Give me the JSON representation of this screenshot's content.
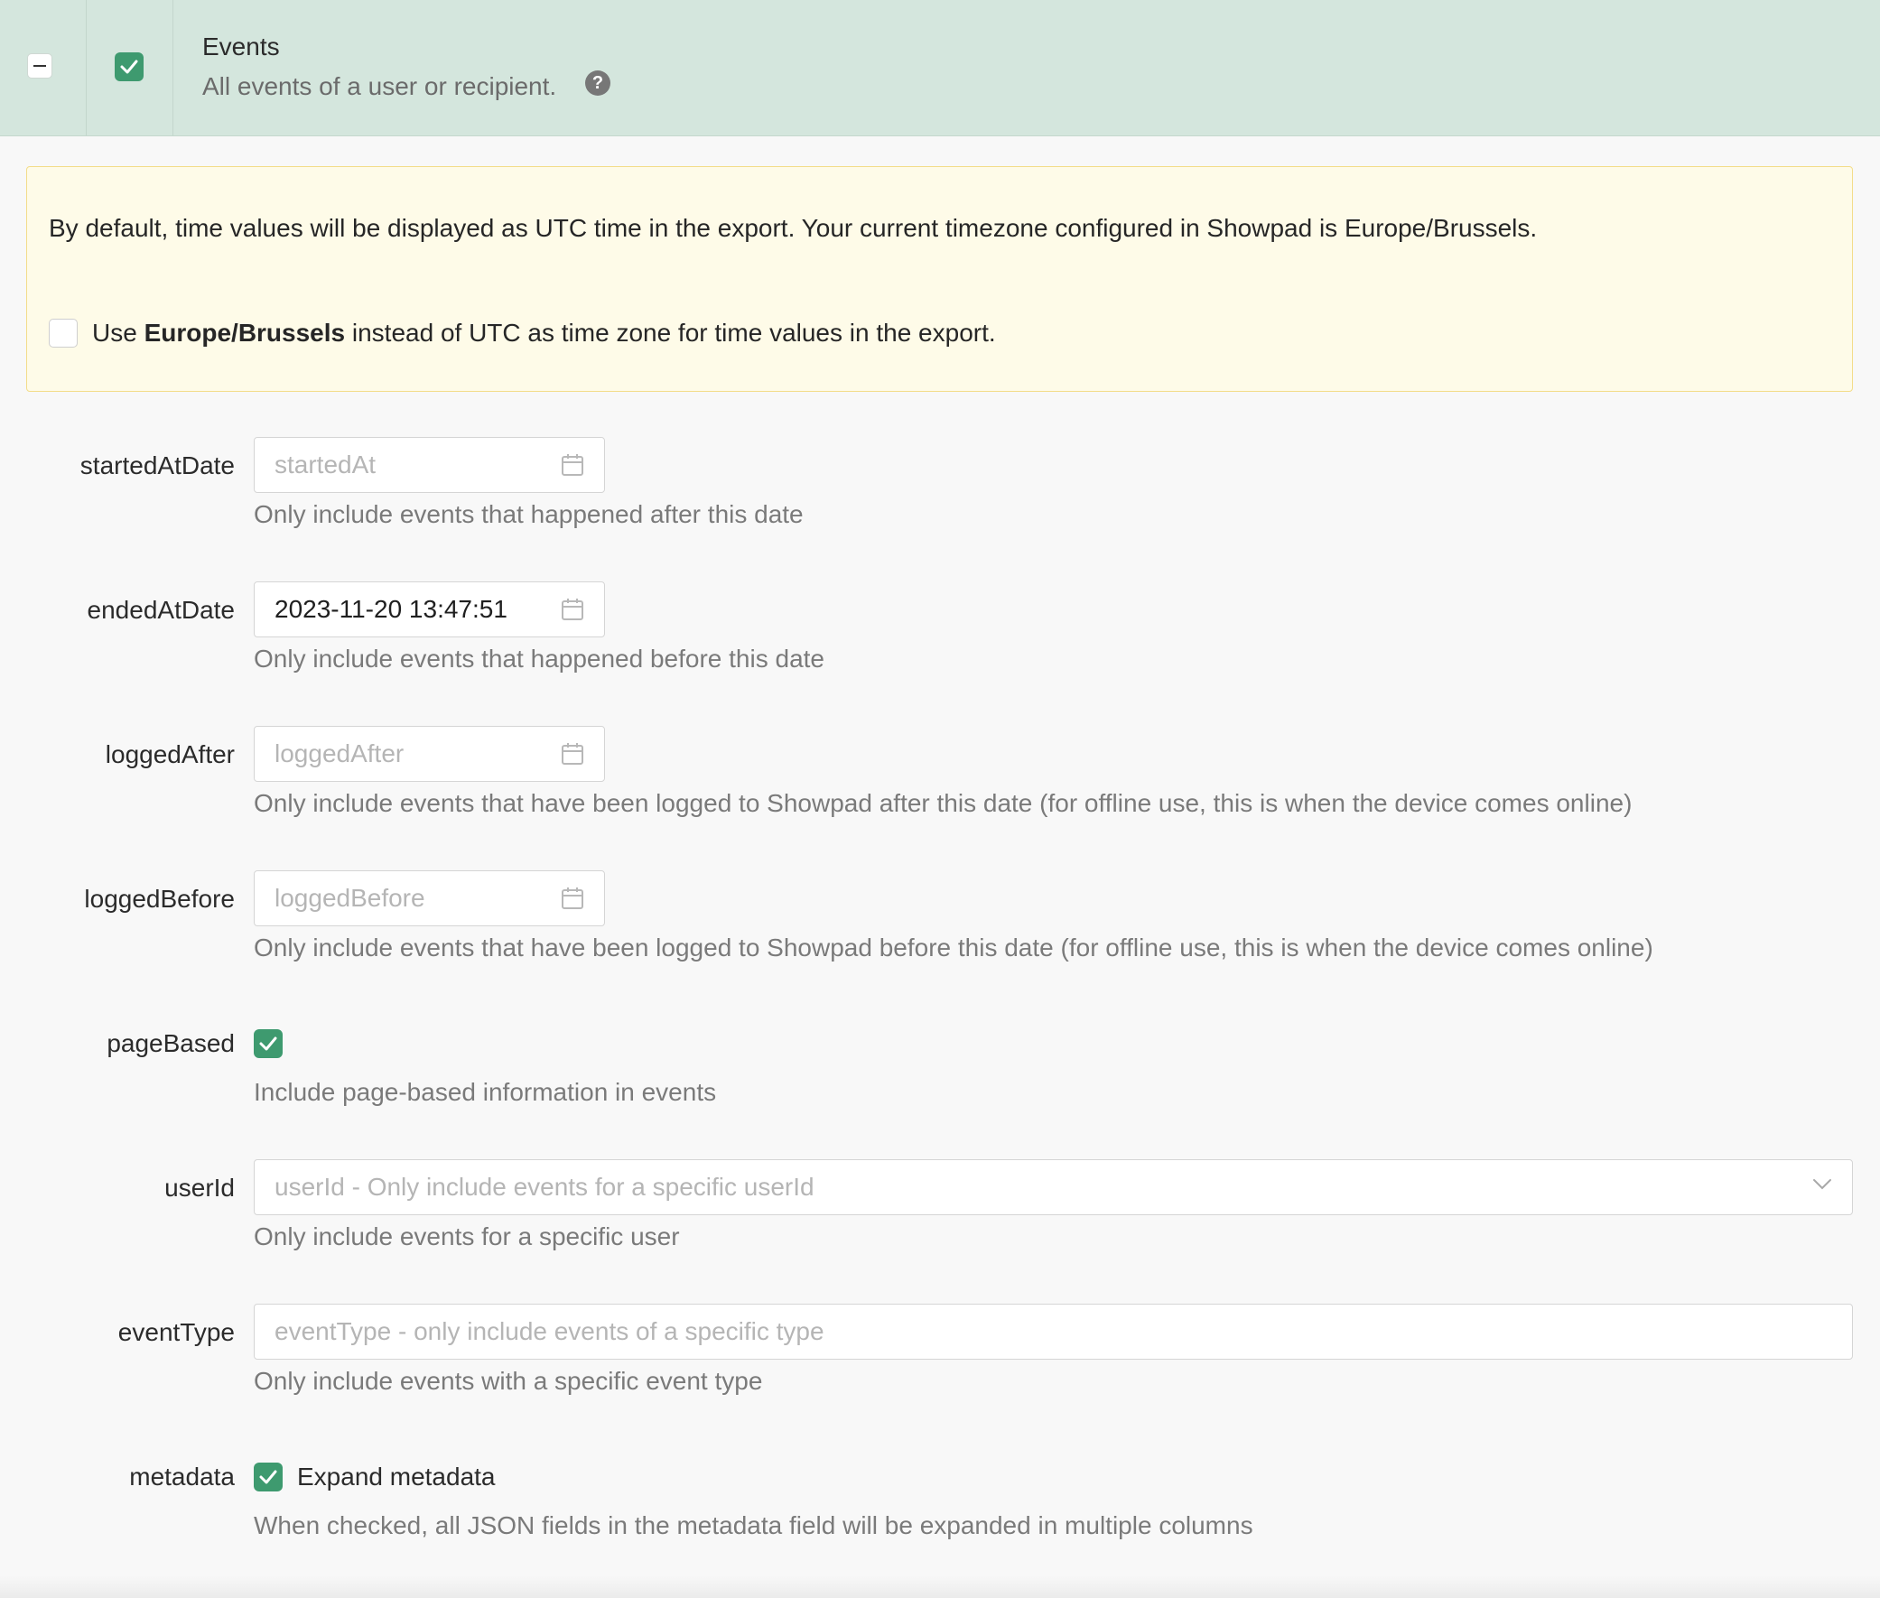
{
  "header": {
    "title": "Events",
    "subtitle": "All events of a user or recipient.",
    "help": "?"
  },
  "notice": {
    "text": "By default, time values will be displayed as UTC time in the export. Your current timezone configured in Showpad is Europe/Brussels.",
    "checkbox_prefix": "Use ",
    "checkbox_zone": "Europe/Brussels",
    "checkbox_suffix": " instead of UTC as time zone for time values in the export."
  },
  "fields": {
    "startedAtDate": {
      "label": "startedAtDate",
      "placeholder": "startedAt",
      "help": "Only include events that happened after this date"
    },
    "endedAtDate": {
      "label": "endedAtDate",
      "value": "2023-11-20 13:47:51",
      "help": "Only include events that happened before this date"
    },
    "loggedAfter": {
      "label": "loggedAfter",
      "placeholder": "loggedAfter",
      "help": "Only include events that have been logged to Showpad after this date (for offline use, this is when the device comes online)"
    },
    "loggedBefore": {
      "label": "loggedBefore",
      "placeholder": "loggedBefore",
      "help": "Only include events that have been logged to Showpad before this date (for offline use, this is when the device comes online)"
    },
    "pageBased": {
      "label": "pageBased",
      "help": "Include page-based information in events"
    },
    "userId": {
      "label": "userId",
      "placeholder": "userId - Only include events for a specific userId",
      "help": "Only include events for a specific user"
    },
    "eventType": {
      "label": "eventType",
      "placeholder": "eventType - only include events of a specific type",
      "help": "Only include events with a specific event type"
    },
    "metadata": {
      "label": "metadata",
      "checkbox_label": "Expand metadata",
      "help": "When checked, all JSON fields in the metadata field will be expanded in multiple columns"
    }
  },
  "colors": {
    "accent": "#3e9a6f",
    "header_bg": "#d4e6dd",
    "notice_bg": "#fefbe8"
  }
}
